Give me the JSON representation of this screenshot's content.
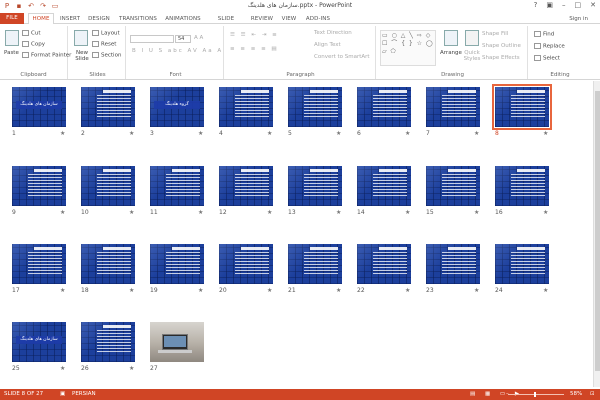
{
  "window": {
    "title": "سازمان های هلدینگ.pptx - PowerPoint",
    "signin": "Sign in"
  },
  "tabs": [
    "FILE",
    "HOME",
    "INSERT",
    "DESIGN",
    "TRANSITIONS",
    "ANIMATIONS",
    "SLIDE SHOW",
    "REVIEW",
    "VIEW",
    "ADD-INS"
  ],
  "ribbon": {
    "clipboard": {
      "label": "Clipboard",
      "paste": "Paste",
      "cut": "Cut",
      "copy": "Copy",
      "format_painter": "Format Painter"
    },
    "slides": {
      "label": "Slides",
      "new_slide": "New Slide",
      "layout": "Layout",
      "reset": "Reset",
      "section": "Section"
    },
    "font": {
      "label": "Font",
      "size": "54"
    },
    "paragraph": {
      "label": "Paragraph",
      "text_direction": "Text Direction",
      "align_text": "Align Text",
      "convert": "Convert to SmartArt"
    },
    "drawing": {
      "label": "Drawing",
      "arrange": "Arrange",
      "quick_styles": "Quick Styles",
      "shape_fill": "Shape Fill",
      "shape_outline": "Shape Outline",
      "shape_effects": "Shape Effects"
    },
    "editing": {
      "label": "Editing",
      "find": "Find",
      "replace": "Replace",
      "select": "Select"
    }
  },
  "slides": [
    {
      "n": "1",
      "title": "سازمان های هلدینگ"
    },
    {
      "n": "2"
    },
    {
      "n": "3",
      "title": "گروه هلدینگ"
    },
    {
      "n": "4"
    },
    {
      "n": "5"
    },
    {
      "n": "6"
    },
    {
      "n": "7"
    },
    {
      "n": "8",
      "selected": true
    },
    {
      "n": "9"
    },
    {
      "n": "10"
    },
    {
      "n": "11"
    },
    {
      "n": "12"
    },
    {
      "n": "13"
    },
    {
      "n": "14"
    },
    {
      "n": "15"
    },
    {
      "n": "16"
    },
    {
      "n": "17"
    },
    {
      "n": "18"
    },
    {
      "n": "19"
    },
    {
      "n": "20"
    },
    {
      "n": "21"
    },
    {
      "n": "22"
    },
    {
      "n": "23"
    },
    {
      "n": "24"
    },
    {
      "n": "25",
      "title": "سازمان های هلدینگ"
    },
    {
      "n": "26"
    },
    {
      "n": "27",
      "photo": true
    }
  ],
  "status": {
    "slide_info": "SLIDE 8 OF 27",
    "language": "PERSIAN",
    "zoom": "58%"
  }
}
